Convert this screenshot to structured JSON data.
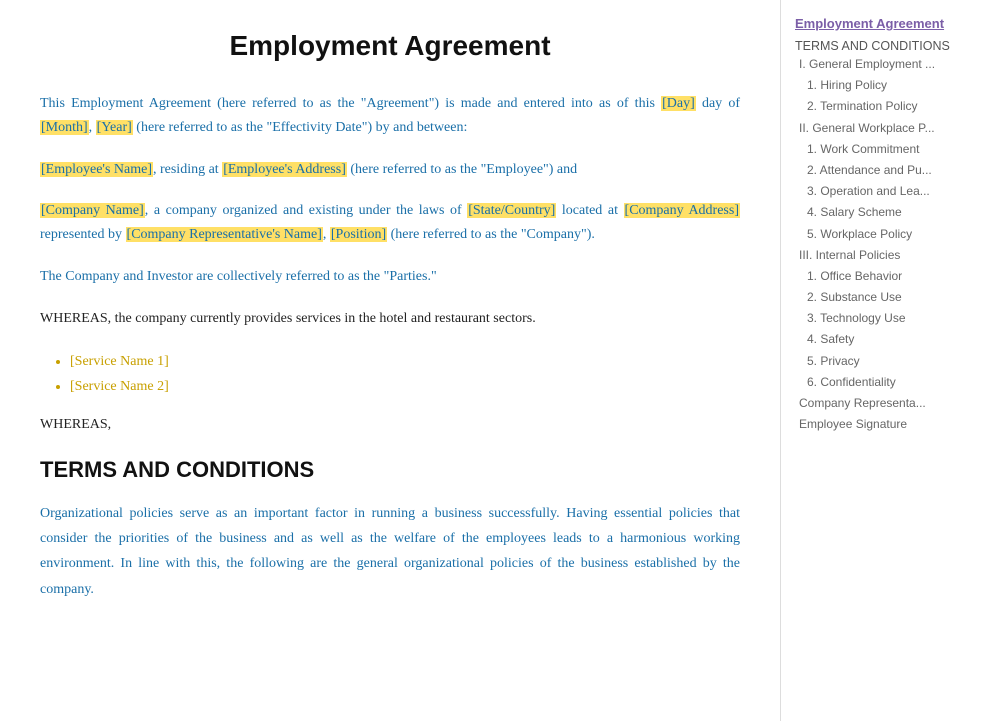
{
  "header": {
    "title": "Employment Agreement"
  },
  "main": {
    "intro1": "This Employment Agreement (here referred to as the \"Agreement\") is made and entered into as of this",
    "intro1_day": "[Day]",
    "intro1_mid": "day of",
    "intro1_month": "[Month]",
    "intro1_comma": ",",
    "intro1_year": "[Year]",
    "intro1_end": "(here referred to as the \"Effectivity Date\") by and between:",
    "intro2_start": "",
    "intro2_name": "[Employee's Name]",
    "intro2_mid": ", residing at",
    "intro2_address": "[Employee's Address]",
    "intro2_end": "(here referred to as the \"Employee\") and",
    "intro3_company": "[Company Name]",
    "intro3_mid": ", a company organized and existing under the laws of",
    "intro3_state": "[State/Country]",
    "intro3_loc": "located at",
    "intro3_addr": "[Company Address]",
    "intro3_rep_pre": "represented by",
    "intro3_rep": "[Company Representative's Name]",
    "intro3_pos": "[Position]",
    "intro3_end": "(here referred to as the \"Company\").",
    "parties_text": "The Company and Investor are collectively referred to as the \"Parties.\"",
    "whereas1": "WHEREAS, the company currently provides services in the hotel and restaurant sectors.",
    "services": [
      "[Service Name 1]",
      "[Service Name 2]"
    ],
    "whereas2": "WHEREAS,",
    "terms_heading": "TERMS AND CONDITIONS",
    "terms_body": "Organizational policies serve as an important factor in running a business successfully. Having essential policies that consider the priorities of the business and as well as the welfare of the employees leads to a harmonious working environment. In line with this, the following are the general organizational policies of the business established by the company."
  },
  "sidebar": {
    "title": "Employment Agreement",
    "items": [
      {
        "type": "section",
        "label": "TERMS AND CONDITIONS",
        "indent": 0
      },
      {
        "type": "item",
        "label": "I. General Employment ...",
        "indent": 1
      },
      {
        "type": "item",
        "label": "1. Hiring Policy",
        "indent": 2
      },
      {
        "type": "item",
        "label": "2. Termination Policy",
        "indent": 2
      },
      {
        "type": "item",
        "label": "II. General Workplace P...",
        "indent": 1
      },
      {
        "type": "item",
        "label": "1. Work Commitment",
        "indent": 2
      },
      {
        "type": "item",
        "label": "2. Attendance and Pu...",
        "indent": 2
      },
      {
        "type": "item",
        "label": "3.  Operation and Lea...",
        "indent": 2
      },
      {
        "type": "item",
        "label": "4. Salary Scheme",
        "indent": 2
      },
      {
        "type": "item",
        "label": "5.  Workplace Policy",
        "indent": 2
      },
      {
        "type": "item",
        "label": "III. Internal Policies",
        "indent": 1
      },
      {
        "type": "item",
        "label": "1. Office Behavior",
        "indent": 2
      },
      {
        "type": "item",
        "label": "2. Substance Use",
        "indent": 2
      },
      {
        "type": "item",
        "label": "3. Technology Use",
        "indent": 2
      },
      {
        "type": "item",
        "label": "4. Safety",
        "indent": 2
      },
      {
        "type": "item",
        "label": "5. Privacy",
        "indent": 2
      },
      {
        "type": "item",
        "label": "6. Confidentiality",
        "indent": 2
      },
      {
        "type": "item",
        "label": "Company Representa...",
        "indent": 1
      },
      {
        "type": "item",
        "label": "Employee Signature",
        "indent": 1
      }
    ]
  }
}
